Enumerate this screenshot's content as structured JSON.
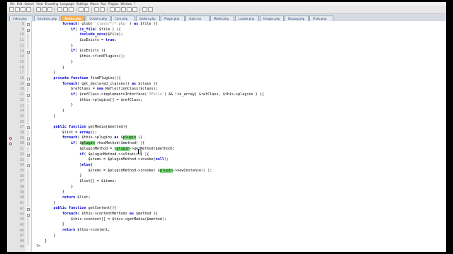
{
  "menubar": {
    "items": [
      "File",
      "Edit",
      "Search",
      "View",
      "Encoding",
      "Language",
      "Settings",
      "Macro",
      "Run",
      "Plugins",
      "Window",
      "?"
    ]
  },
  "toolbar": {
    "buttons": [
      "new-file-icon",
      "open-file-icon",
      "save-icon",
      "save-all-icon",
      "close-icon",
      "close-all-icon",
      "print-icon",
      "cut-icon",
      "copy-icon",
      "paste-icon",
      "undo-icon",
      "redo-icon",
      "find-icon",
      "replace-icon",
      "zoom-in-icon",
      "zoom-out-icon",
      "sync-scroll-icon",
      "wrap-icon",
      "indent-guide-icon",
      "macro-record-icon",
      "macro-play-icon"
    ]
  },
  "tabs": {
    "items": [
      {
        "label": "index.php",
        "active": false
      },
      {
        "label": "functions.php",
        "active": false
      },
      {
        "label": "Media.php",
        "active": true
      },
      {
        "label": "Content.php",
        "active": false
      },
      {
        "label": "Core.php",
        "active": false
      },
      {
        "label": "Gallery.php",
        "active": false
      },
      {
        "label": "Plugin.php",
        "active": false
      },
      {
        "label": "style.css",
        "active": false
      },
      {
        "label": "Model.php",
        "active": false
      },
      {
        "label": "Loader.php",
        "active": false
      },
      {
        "label": "Images.php",
        "active": false
      },
      {
        "label": "Display.php",
        "active": false
      },
      {
        "label": "IFolio.php",
        "active": false
      }
    ]
  },
  "colors": {
    "accent_tab": "#ffb04a",
    "keyword": "#0000cc",
    "highlight": "#7ee07e"
  },
  "code": {
    "lines": [
      {
        "n": "8",
        "text": [
          [
            "            ",
            ""
          ],
          [
            "foreach",
            "kw"
          ],
          [
            "( glob( ",
            ""
          ],
          [
            "'class/*/*.php'",
            "str"
          ],
          [
            " ) ",
            ""
          ],
          [
            "as",
            "kw"
          ],
          [
            " $file ){",
            ""
          ]
        ]
      },
      {
        "n": "9",
        "text": [
          [
            "                ",
            ""
          ],
          [
            "if",
            "kw"
          ],
          [
            "( ",
            ""
          ],
          [
            "is_file",
            "kw"
          ],
          [
            "( $file ) ){",
            ""
          ]
        ]
      },
      {
        "n": "10",
        "text": [
          [
            "                    ",
            ""
          ],
          [
            "include_once",
            "kw"
          ],
          [
            "($file);",
            ""
          ]
        ]
      },
      {
        "n": "11",
        "text": [
          [
            "                    $isExists = ",
            ""
          ],
          [
            "true",
            "kw"
          ],
          [
            ";",
            ""
          ]
        ]
      },
      {
        "n": "12",
        "text": [
          [
            "                }",
            ""
          ]
        ]
      },
      {
        "n": "13",
        "text": [
          [
            "                ",
            ""
          ],
          [
            "if",
            "kw"
          ],
          [
            "( $isExists ){",
            ""
          ]
        ]
      },
      {
        "n": "14",
        "text": [
          [
            "                    $this->findPlugins();",
            ""
          ]
        ]
      },
      {
        "n": "15",
        "text": [
          [
            "                }",
            ""
          ]
        ]
      },
      {
        "n": "16",
        "text": [
          [
            "            }",
            ""
          ]
        ]
      },
      {
        "n": "17",
        "text": [
          [
            "        }",
            ""
          ]
        ]
      },
      {
        "n": "18",
        "text": [
          [
            "        ",
            ""
          ],
          [
            "private function",
            "kw"
          ],
          [
            " findPlugins(){",
            ""
          ]
        ]
      },
      {
        "n": "19",
        "text": [
          [
            "            ",
            ""
          ],
          [
            "foreach",
            "kw"
          ],
          [
            "( get_declared_classes() ",
            ""
          ],
          [
            "as",
            "kw"
          ],
          [
            " $class ){",
            ""
          ]
        ]
      },
      {
        "n": "20",
        "text": [
          [
            "                $refClass = ",
            ""
          ],
          [
            "new",
            "kw"
          ],
          [
            " ReflectionClass($class);",
            ""
          ]
        ]
      },
      {
        "n": "21",
        "text": [
          [
            "                ",
            ""
          ],
          [
            "if",
            "kw"
          ],
          [
            "( $refClass->implementsInterface(",
            ""
          ],
          [
            "'IFolio'",
            "str"
          ],
          [
            ") && !in_array( $refClass, $this->plugins ) ){",
            ""
          ]
        ]
      },
      {
        "n": "22",
        "text": [
          [
            "                    $this->plugins[] = $refClass;",
            ""
          ]
        ]
      },
      {
        "n": "23",
        "text": [
          [
            "                }",
            ""
          ]
        ]
      },
      {
        "n": "24",
        "text": [
          [
            "            }",
            ""
          ]
        ]
      },
      {
        "n": "25",
        "text": [
          [
            "        }",
            ""
          ]
        ]
      },
      {
        "n": "26",
        "text": [
          [
            "",
            ""
          ]
        ]
      },
      {
        "n": "27",
        "text": [
          [
            "        ",
            ""
          ],
          [
            "public function",
            "kw"
          ],
          [
            " getMedia($method){",
            ""
          ]
        ]
      },
      {
        "n": "28",
        "text": [
          [
            "            $list = ",
            ""
          ],
          [
            "array",
            "kw"
          ],
          [
            "();",
            ""
          ]
        ]
      },
      {
        "n": "29",
        "text": [
          [
            "            ",
            ""
          ],
          [
            "foreach",
            "kw"
          ],
          [
            "( $this->plugins ",
            ""
          ],
          [
            "as",
            "kw"
          ],
          [
            " $",
            ""
          ],
          [
            "plugin",
            "hl"
          ],
          [
            " ){",
            ""
          ]
        ]
      },
      {
        "n": "30",
        "text": [
          [
            "                ",
            ""
          ],
          [
            "if",
            "kw"
          ],
          [
            "( $",
            ""
          ],
          [
            "plugin",
            "hl"
          ],
          [
            "->hasMethod($method) ){",
            ""
          ]
        ]
      },
      {
        "n": "31",
        "text": [
          [
            "                    $pluginMethod = $",
            ""
          ],
          [
            "plugin",
            "hl"
          ],
          [
            "->getMethod($method);",
            ""
          ]
        ]
      },
      {
        "n": "32",
        "text": [
          [
            "                    ",
            ""
          ],
          [
            "if",
            "kw"
          ],
          [
            "( $pluginMethod->isStatic() ){",
            ""
          ]
        ]
      },
      {
        "n": "33",
        "text": [
          [
            "                        $items = $pluginMethod->invoke(",
            ""
          ],
          [
            "null",
            "kw"
          ],
          [
            ");",
            ""
          ]
        ]
      },
      {
        "n": "34",
        "text": [
          [
            "                    }",
            ""
          ],
          [
            "else",
            "kw"
          ],
          [
            "{",
            ""
          ]
        ]
      },
      {
        "n": "35",
        "text": [
          [
            "                        $items = $pluginMethod->invoke( $",
            ""
          ],
          [
            "plugin",
            "hl"
          ],
          [
            "->newInstance() );",
            ""
          ]
        ]
      },
      {
        "n": "36",
        "text": [
          [
            "                    }",
            ""
          ]
        ]
      },
      {
        "n": "37",
        "text": [
          [
            "                    $list[] = $items;",
            ""
          ]
        ]
      },
      {
        "n": "38",
        "text": [
          [
            "                }",
            ""
          ]
        ]
      },
      {
        "n": "39",
        "text": [
          [
            "            }",
            ""
          ]
        ]
      },
      {
        "n": "40",
        "text": [
          [
            "            ",
            ""
          ],
          [
            "return",
            "kw"
          ],
          [
            " $list;",
            ""
          ]
        ]
      },
      {
        "n": "41",
        "text": [
          [
            "        }",
            ""
          ]
        ]
      },
      {
        "n": "42",
        "text": [
          [
            "        ",
            ""
          ],
          [
            "public function",
            "kw"
          ],
          [
            " getContent(){",
            ""
          ]
        ]
      },
      {
        "n": "43",
        "text": [
          [
            "            ",
            ""
          ],
          [
            "foreach",
            "kw"
          ],
          [
            "( $this->contentMethods ",
            ""
          ],
          [
            "as",
            "kw"
          ],
          [
            " $method ){",
            ""
          ]
        ]
      },
      {
        "n": "44",
        "text": [
          [
            "                $this->content[] = $this->getMedia($method);",
            ""
          ]
        ]
      },
      {
        "n": "45",
        "text": [
          [
            "            }",
            ""
          ]
        ]
      },
      {
        "n": "46",
        "text": [
          [
            "            ",
            ""
          ],
          [
            "return",
            "kw"
          ],
          [
            " $this->content;",
            ""
          ]
        ]
      },
      {
        "n": "47",
        "text": [
          [
            "        }",
            ""
          ]
        ]
      },
      {
        "n": "48",
        "text": [
          [
            "    }",
            ""
          ]
        ]
      },
      {
        "n": "49",
        "text": [
          [
            "?>",
            ""
          ]
        ]
      }
    ],
    "fold_rows": [
      "8",
      "9",
      "13",
      "18",
      "19",
      "21",
      "27",
      "29",
      "30",
      "32",
      "34",
      "42",
      "43"
    ],
    "bookmark_rows": [
      "29",
      "30"
    ]
  }
}
